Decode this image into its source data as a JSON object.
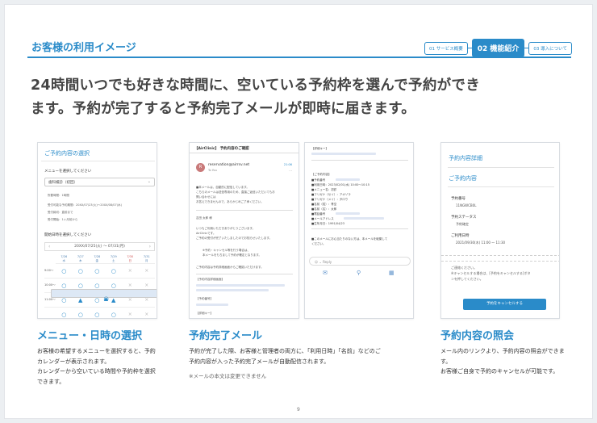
{
  "header": {
    "title": "お客様の利用イメージ",
    "tabs": [
      {
        "label": "01 サービス概要",
        "active": false
      },
      {
        "label": "02 機能紹介",
        "active": true
      },
      {
        "label": "03 導入について",
        "active": false
      }
    ]
  },
  "headline": {
    "line1": "24時間いつでも好きな時間に、空いている予約枠を選んで予約ができ",
    "line2": "ます。予約が完了すると予約完了メールが即時に届きます。"
  },
  "screen1": {
    "title": "ご予約内容の選択",
    "menu_label": "メニューを選択してください",
    "menu_value": "歯科検診（初回）",
    "meta": [
      "所要時間：1時間",
      "受付可能な予約期間：20XX/07/23(火)～20XX/08/07(水)",
      "受付締切：直前まで",
      "受付開始：1ヶ月前から"
    ],
    "datetime_label": "開始日時を選択してください",
    "range": "20XX/07/25(火) ～ 07/31(月)",
    "days": [
      {
        "date": "7/25",
        "dow": "火"
      },
      {
        "date": "7/26",
        "dow": "水"
      },
      {
        "date": "7/27",
        "dow": "木"
      },
      {
        "date": "7/28",
        "dow": "金"
      },
      {
        "date": "7/29",
        "dow": "土"
      },
      {
        "date": "7/30",
        "dow": "日"
      },
      {
        "date": "7/31",
        "dow": "月"
      }
    ],
    "rows": [
      {
        "time": "9:00～",
        "slots": [
          "○",
          "○",
          "○",
          "○",
          "○",
          "×",
          "×"
        ]
      },
      {
        "time": "10:00～",
        "slots": [
          "○",
          "○",
          "○",
          "○",
          "○",
          "×",
          "×"
        ]
      },
      {
        "time": "11:00～",
        "slots": [
          "▲",
          "○",
          "▲",
          "○",
          "▲",
          "×",
          "×"
        ]
      },
      {
        "time": "",
        "slots": [
          "○",
          "○",
          "○",
          "○",
          "○",
          "×",
          "×"
        ]
      }
    ]
  },
  "screen2": {
    "subject": "【AirClinic】 予約内容のご確認",
    "avatar": "R",
    "from": "reservation@airrsv.net",
    "to": "To You",
    "time": "21:06",
    "body1": [
      "■本メールは、自動的に配信しています。",
      "こちらのメールは送信専用のため、直接ご返信いただいてもお",
      "問い合わせには",
      "お答えできませんので、あらかじめご了承ください。"
    ],
    "greeting": "吉田 太郎 様",
    "body2": [
      "いつもご利用いただきありがとうございます。",
      "AirClinicです。",
      "ご予約の受付が完了いたしましたのでお知らせいたします。"
    ],
    "body3": [
      "※予約・キャンセル等を行う場合は、",
      "本メールをもちまして予約が確定となります。"
    ],
    "body4": "ご予約内容は予約詳細画面からご確認いただけます。",
    "section1": "【予約内容詳細画面】",
    "section2": "【予約番号】",
    "section3": "【詳細キー】"
  },
  "screen3": {
    "top": "【詳細キー】",
    "section": "【ご予約内容】",
    "fields": [
      "■予約番号",
      "■利用日時：2023/02/01(水) 10:00～10:15",
      "■メニュー名：初診",
      "■フリガナ（セイ）：アオゾラ",
      "■フリガナ（メイ）：タロウ",
      "■名前（姓）：青空",
      "■名前（名）：太郎",
      "■電話番号",
      "■メールアドレス",
      "■生年月日：1991/04/23"
    ],
    "footer": [
      "■このメールにお心当たりのない方は、本メールを破棄して",
      "ください。"
    ],
    "reply": "Reply"
  },
  "screen4": {
    "title": "予約内容詳細",
    "section": "ご予約内容",
    "number_label": "予約番号",
    "number_value": "11NGWCB0L",
    "status_label": "予約ステータス",
    "status_value": "予約確定",
    "date_label": "ご利用日時",
    "date_value": "2021/09/30(木) 11:00 ～ 11:30",
    "note1": "ご連絡ください。",
    "note2": "※キャンセルする場合は、[予約をキャンセルする]ボタ",
    "note3": "ンを押してください。",
    "button": "予約をキャンセルする"
  },
  "features": [
    {
      "title": "メニュー・日時の選択",
      "desc": [
        "お客様の希望するメニューを選択すると、予約カレンダーが表示されます。",
        "カレンダーから空いている時間や予約枠を選択できます。"
      ]
    },
    {
      "title": "予約完了メール",
      "desc": [
        "予約が完了した際、お客様と管理者の両方に、「利用日時」「名前」などのご",
        "予約内容が入った予約完了メールが自動配信されます。"
      ],
      "note": "※メールの本文は変更できません"
    },
    {
      "title": "予約内容の照会",
      "desc": [
        "メール内のリンクより、予約内容の照会ができます。",
        "お客様ご自身で予約のキャンセルが可能です。"
      ]
    }
  ],
  "page_number": "9"
}
